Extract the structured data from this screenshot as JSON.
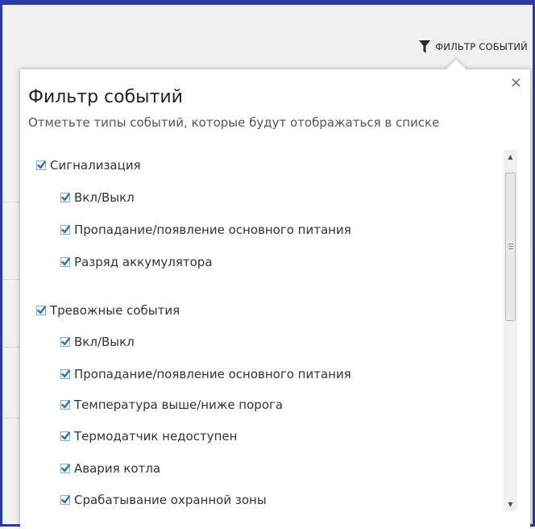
{
  "header": {
    "filter_link_label": "ФИЛЬТР СОБЫТИЙ",
    "filter_icon": "funnel-icon"
  },
  "popup": {
    "title": "Фильтр событий",
    "subtitle": "Отметьте типы событий, которые будут отображаться в списке",
    "close_label": "×",
    "groups": [
      {
        "label": "Сигнализация",
        "checked": true,
        "items": [
          {
            "label": "Вкл/Выкл",
            "checked": true
          },
          {
            "label": "Пропадание/появление основного питания",
            "checked": true
          },
          {
            "label": "Разряд аккумулятора",
            "checked": true
          }
        ]
      },
      {
        "label": "Тревожные события",
        "checked": true,
        "items": [
          {
            "label": "Вкл/Выкл",
            "checked": true
          },
          {
            "label": "Пропадание/появление основного питания",
            "checked": true
          },
          {
            "label": "Температура выше/ниже порога",
            "checked": true
          },
          {
            "label": "Термодатчик недоступен",
            "checked": true
          },
          {
            "label": "Авария котла",
            "checked": true
          },
          {
            "label": "Срабатывание охранной зоны",
            "checked": true
          }
        ]
      }
    ]
  },
  "colors": {
    "frame_border": "#2b3aa8",
    "checkmark": "#1f73c9",
    "background": "#f1f1f1"
  }
}
